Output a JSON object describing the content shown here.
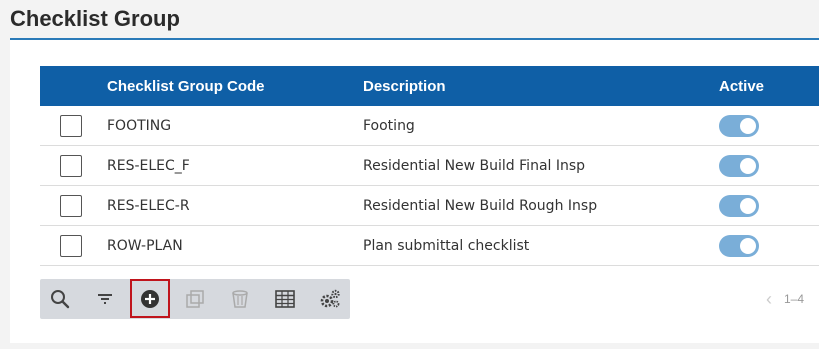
{
  "page": {
    "title": "Checklist Group"
  },
  "grid": {
    "headers": {
      "code": "Checklist Group Code",
      "description": "Description",
      "active": "Active"
    },
    "rows": [
      {
        "code": "FOOTING",
        "description": "Footing",
        "active": true
      },
      {
        "code": "RES-ELEC_F",
        "description": "Residential New Build Final Insp",
        "active": true
      },
      {
        "code": "RES-ELEC-R",
        "description": "Residential New Build Rough Insp",
        "active": true
      },
      {
        "code": "ROW-PLAN",
        "description": "Plan submittal checklist",
        "active": true
      }
    ]
  },
  "toolbar": {
    "buttons": [
      {
        "icon": "search-icon",
        "enabled": true
      },
      {
        "icon": "filter-icon",
        "enabled": true
      },
      {
        "icon": "add-circle-icon",
        "enabled": true,
        "highlighted": true
      },
      {
        "icon": "copy-icon",
        "enabled": false
      },
      {
        "icon": "trash-icon",
        "enabled": false
      },
      {
        "icon": "grid-layout-icon",
        "enabled": true
      },
      {
        "icon": "settings-gears-icon",
        "enabled": true
      }
    ]
  },
  "pager": {
    "range_text": "1–4"
  },
  "colors": {
    "header_bg": "#0f5fa6",
    "title_rule": "#2a7ab8",
    "toggle_on": "#7aaed8",
    "highlight_border": "#c0141c",
    "toolbar_bg": "#d6d9de"
  }
}
